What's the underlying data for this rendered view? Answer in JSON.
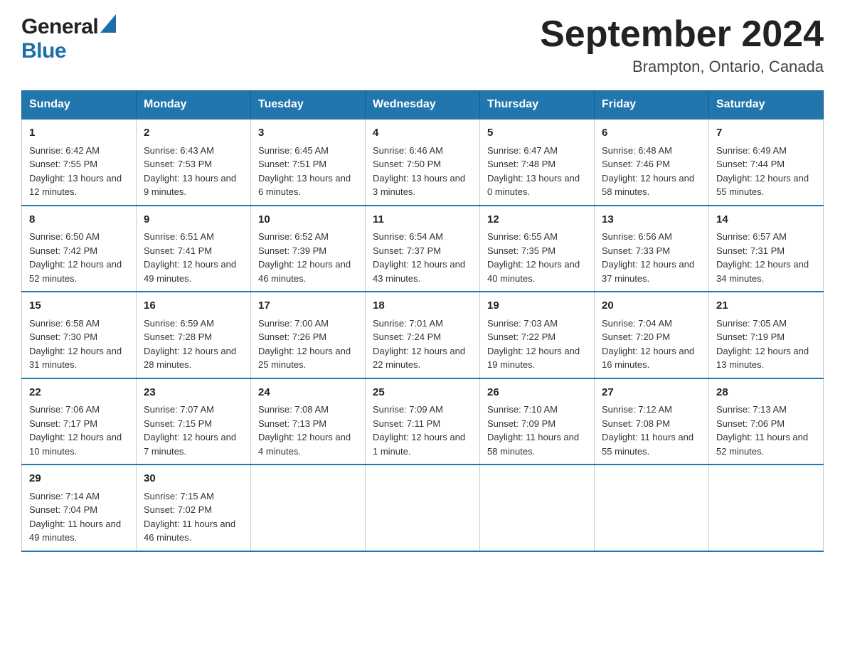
{
  "header": {
    "logo_general": "General",
    "logo_blue": "Blue",
    "title": "September 2024",
    "subtitle": "Brampton, Ontario, Canada"
  },
  "days_of_week": [
    "Sunday",
    "Monday",
    "Tuesday",
    "Wednesday",
    "Thursday",
    "Friday",
    "Saturday"
  ],
  "weeks": [
    [
      {
        "day": "1",
        "sunrise": "Sunrise: 6:42 AM",
        "sunset": "Sunset: 7:55 PM",
        "daylight": "Daylight: 13 hours and 12 minutes."
      },
      {
        "day": "2",
        "sunrise": "Sunrise: 6:43 AM",
        "sunset": "Sunset: 7:53 PM",
        "daylight": "Daylight: 13 hours and 9 minutes."
      },
      {
        "day": "3",
        "sunrise": "Sunrise: 6:45 AM",
        "sunset": "Sunset: 7:51 PM",
        "daylight": "Daylight: 13 hours and 6 minutes."
      },
      {
        "day": "4",
        "sunrise": "Sunrise: 6:46 AM",
        "sunset": "Sunset: 7:50 PM",
        "daylight": "Daylight: 13 hours and 3 minutes."
      },
      {
        "day": "5",
        "sunrise": "Sunrise: 6:47 AM",
        "sunset": "Sunset: 7:48 PM",
        "daylight": "Daylight: 13 hours and 0 minutes."
      },
      {
        "day": "6",
        "sunrise": "Sunrise: 6:48 AM",
        "sunset": "Sunset: 7:46 PM",
        "daylight": "Daylight: 12 hours and 58 minutes."
      },
      {
        "day": "7",
        "sunrise": "Sunrise: 6:49 AM",
        "sunset": "Sunset: 7:44 PM",
        "daylight": "Daylight: 12 hours and 55 minutes."
      }
    ],
    [
      {
        "day": "8",
        "sunrise": "Sunrise: 6:50 AM",
        "sunset": "Sunset: 7:42 PM",
        "daylight": "Daylight: 12 hours and 52 minutes."
      },
      {
        "day": "9",
        "sunrise": "Sunrise: 6:51 AM",
        "sunset": "Sunset: 7:41 PM",
        "daylight": "Daylight: 12 hours and 49 minutes."
      },
      {
        "day": "10",
        "sunrise": "Sunrise: 6:52 AM",
        "sunset": "Sunset: 7:39 PM",
        "daylight": "Daylight: 12 hours and 46 minutes."
      },
      {
        "day": "11",
        "sunrise": "Sunrise: 6:54 AM",
        "sunset": "Sunset: 7:37 PM",
        "daylight": "Daylight: 12 hours and 43 minutes."
      },
      {
        "day": "12",
        "sunrise": "Sunrise: 6:55 AM",
        "sunset": "Sunset: 7:35 PM",
        "daylight": "Daylight: 12 hours and 40 minutes."
      },
      {
        "day": "13",
        "sunrise": "Sunrise: 6:56 AM",
        "sunset": "Sunset: 7:33 PM",
        "daylight": "Daylight: 12 hours and 37 minutes."
      },
      {
        "day": "14",
        "sunrise": "Sunrise: 6:57 AM",
        "sunset": "Sunset: 7:31 PM",
        "daylight": "Daylight: 12 hours and 34 minutes."
      }
    ],
    [
      {
        "day": "15",
        "sunrise": "Sunrise: 6:58 AM",
        "sunset": "Sunset: 7:30 PM",
        "daylight": "Daylight: 12 hours and 31 minutes."
      },
      {
        "day": "16",
        "sunrise": "Sunrise: 6:59 AM",
        "sunset": "Sunset: 7:28 PM",
        "daylight": "Daylight: 12 hours and 28 minutes."
      },
      {
        "day": "17",
        "sunrise": "Sunrise: 7:00 AM",
        "sunset": "Sunset: 7:26 PM",
        "daylight": "Daylight: 12 hours and 25 minutes."
      },
      {
        "day": "18",
        "sunrise": "Sunrise: 7:01 AM",
        "sunset": "Sunset: 7:24 PM",
        "daylight": "Daylight: 12 hours and 22 minutes."
      },
      {
        "day": "19",
        "sunrise": "Sunrise: 7:03 AM",
        "sunset": "Sunset: 7:22 PM",
        "daylight": "Daylight: 12 hours and 19 minutes."
      },
      {
        "day": "20",
        "sunrise": "Sunrise: 7:04 AM",
        "sunset": "Sunset: 7:20 PM",
        "daylight": "Daylight: 12 hours and 16 minutes."
      },
      {
        "day": "21",
        "sunrise": "Sunrise: 7:05 AM",
        "sunset": "Sunset: 7:19 PM",
        "daylight": "Daylight: 12 hours and 13 minutes."
      }
    ],
    [
      {
        "day": "22",
        "sunrise": "Sunrise: 7:06 AM",
        "sunset": "Sunset: 7:17 PM",
        "daylight": "Daylight: 12 hours and 10 minutes."
      },
      {
        "day": "23",
        "sunrise": "Sunrise: 7:07 AM",
        "sunset": "Sunset: 7:15 PM",
        "daylight": "Daylight: 12 hours and 7 minutes."
      },
      {
        "day": "24",
        "sunrise": "Sunrise: 7:08 AM",
        "sunset": "Sunset: 7:13 PM",
        "daylight": "Daylight: 12 hours and 4 minutes."
      },
      {
        "day": "25",
        "sunrise": "Sunrise: 7:09 AM",
        "sunset": "Sunset: 7:11 PM",
        "daylight": "Daylight: 12 hours and 1 minute."
      },
      {
        "day": "26",
        "sunrise": "Sunrise: 7:10 AM",
        "sunset": "Sunset: 7:09 PM",
        "daylight": "Daylight: 11 hours and 58 minutes."
      },
      {
        "day": "27",
        "sunrise": "Sunrise: 7:12 AM",
        "sunset": "Sunset: 7:08 PM",
        "daylight": "Daylight: 11 hours and 55 minutes."
      },
      {
        "day": "28",
        "sunrise": "Sunrise: 7:13 AM",
        "sunset": "Sunset: 7:06 PM",
        "daylight": "Daylight: 11 hours and 52 minutes."
      }
    ],
    [
      {
        "day": "29",
        "sunrise": "Sunrise: 7:14 AM",
        "sunset": "Sunset: 7:04 PM",
        "daylight": "Daylight: 11 hours and 49 minutes."
      },
      {
        "day": "30",
        "sunrise": "Sunrise: 7:15 AM",
        "sunset": "Sunset: 7:02 PM",
        "daylight": "Daylight: 11 hours and 46 minutes."
      },
      null,
      null,
      null,
      null,
      null
    ]
  ]
}
